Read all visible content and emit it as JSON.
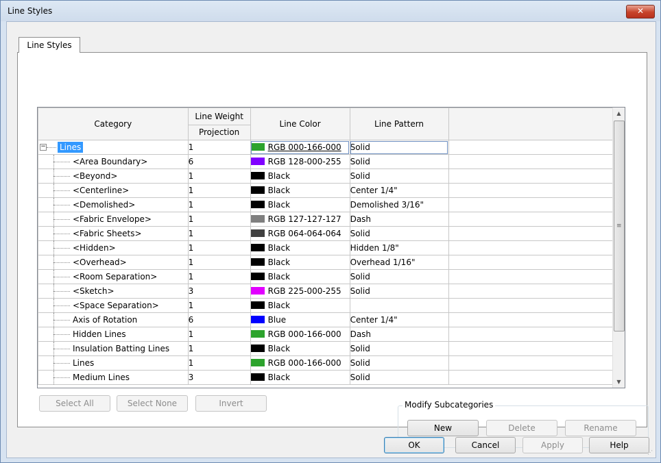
{
  "window": {
    "title": "Line Styles",
    "close_label": "✕"
  },
  "tab": {
    "label": "Line Styles"
  },
  "grid": {
    "headers": {
      "category": "Category",
      "line_weight": "Line Weight",
      "projection": "Projection",
      "line_color": "Line Color",
      "line_pattern": "Line Pattern"
    },
    "rows": [
      {
        "category": "Lines",
        "weight": "1",
        "color": "RGB 000-166-000",
        "swatch": "#2da32d",
        "pattern": "Solid",
        "root": true
      },
      {
        "category": "<Area Boundary>",
        "weight": "6",
        "color": "RGB 128-000-255",
        "swatch": "#8000ff",
        "pattern": "Solid"
      },
      {
        "category": "<Beyond>",
        "weight": "1",
        "color": "Black",
        "swatch": "#000000",
        "pattern": "Solid"
      },
      {
        "category": "<Centerline>",
        "weight": "1",
        "color": "Black",
        "swatch": "#000000",
        "pattern": "Center 1/4\""
      },
      {
        "category": "<Demolished>",
        "weight": "1",
        "color": "Black",
        "swatch": "#000000",
        "pattern": "Demolished 3/16\""
      },
      {
        "category": "<Fabric Envelope>",
        "weight": "1",
        "color": "RGB 127-127-127",
        "swatch": "#7f7f7f",
        "pattern": "Dash"
      },
      {
        "category": "<Fabric Sheets>",
        "weight": "1",
        "color": "RGB 064-064-064",
        "swatch": "#404040",
        "pattern": "Solid"
      },
      {
        "category": "<Hidden>",
        "weight": "1",
        "color": "Black",
        "swatch": "#000000",
        "pattern": "Hidden 1/8\""
      },
      {
        "category": "<Overhead>",
        "weight": "1",
        "color": "Black",
        "swatch": "#000000",
        "pattern": "Overhead 1/16\""
      },
      {
        "category": "<Room Separation>",
        "weight": "1",
        "color": "Black",
        "swatch": "#000000",
        "pattern": "Solid"
      },
      {
        "category": "<Sketch>",
        "weight": "3",
        "color": "RGB 225-000-255",
        "swatch": "#e100ff",
        "pattern": "Solid"
      },
      {
        "category": "<Space Separation>",
        "weight": "1",
        "color": "Black",
        "swatch": "#000000",
        "pattern": ""
      },
      {
        "category": "Axis of Rotation",
        "weight": "6",
        "color": "Blue",
        "swatch": "#0000ff",
        "pattern": "Center 1/4\""
      },
      {
        "category": "Hidden Lines",
        "weight": "1",
        "color": "RGB 000-166-000",
        "swatch": "#2da32d",
        "pattern": "Dash"
      },
      {
        "category": "Insulation Batting Lines",
        "weight": "1",
        "color": "Black",
        "swatch": "#000000",
        "pattern": "Solid"
      },
      {
        "category": "Lines",
        "weight": "1",
        "color": "RGB 000-166-000",
        "swatch": "#2da32d",
        "pattern": "Solid"
      },
      {
        "category": "Medium Lines",
        "weight": "3",
        "color": "Black",
        "swatch": "#000000",
        "pattern": "Solid"
      }
    ]
  },
  "selection_buttons": {
    "select_all": "Select All",
    "select_none": "Select None",
    "invert": "Invert"
  },
  "modify_subcategories": {
    "legend": "Modify Subcategories",
    "new": "New",
    "delete": "Delete",
    "rename": "Rename"
  },
  "footer": {
    "ok": "OK",
    "cancel": "Cancel",
    "apply": "Apply",
    "help": "Help"
  }
}
